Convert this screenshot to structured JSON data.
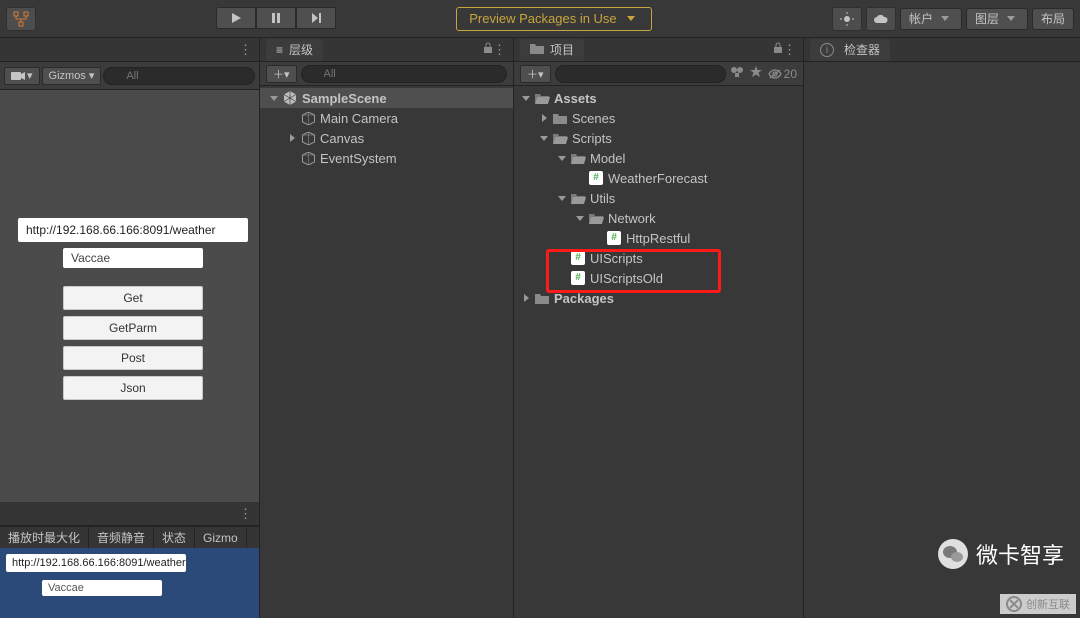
{
  "toolbar": {
    "preview_label": "Preview Packages in Use",
    "account_label": "帐户",
    "layers_label": "图层",
    "layout_label": "布局"
  },
  "scene": {
    "gizmos_label": "Gizmos",
    "search_placeholder": "All",
    "url_value": "http://192.168.66.166:8091/weather",
    "name_value": "Vaccae",
    "btn_get": "Get",
    "btn_getparm": "GetParm",
    "btn_post": "Post",
    "btn_json": "Json",
    "tabs": [
      "播放时最大化",
      "音频静音",
      "状态",
      "Gizmo"
    ],
    "game_url": "http://192.168.66.166:8091/weather",
    "game_name": "Vaccae"
  },
  "hierarchy": {
    "title": "层级",
    "search_placeholder": "All",
    "items": [
      {
        "label": "SampleScene",
        "icon": "unity",
        "bold": true,
        "sel": true,
        "depth": 0,
        "twist": "down"
      },
      {
        "label": "Main Camera",
        "icon": "cube",
        "depth": 1
      },
      {
        "label": "Canvas",
        "icon": "cube",
        "depth": 1,
        "twist": "right"
      },
      {
        "label": "EventSystem",
        "icon": "cube",
        "depth": 1
      }
    ]
  },
  "project": {
    "title": "项目",
    "hidden_count": "20",
    "items": [
      {
        "label": "Assets",
        "icon": "folder-o",
        "bold": true,
        "depth": 0,
        "twist": "down"
      },
      {
        "label": "Scenes",
        "icon": "folder",
        "depth": 1,
        "twist": "right"
      },
      {
        "label": "Scripts",
        "icon": "folder-o",
        "depth": 1,
        "twist": "down"
      },
      {
        "label": "Model",
        "icon": "folder-o",
        "depth": 2,
        "twist": "down"
      },
      {
        "label": "WeatherForecast",
        "icon": "cs",
        "depth": 3
      },
      {
        "label": "Utils",
        "icon": "folder-o",
        "depth": 2,
        "twist": "down"
      },
      {
        "label": "Network",
        "icon": "folder-o",
        "depth": 3,
        "twist": "down"
      },
      {
        "label": "HttpRestful",
        "icon": "cs",
        "depth": 4
      },
      {
        "label": "UIScripts",
        "icon": "cs",
        "depth": 2
      },
      {
        "label": "UIScriptsOld",
        "icon": "cs",
        "depth": 2
      },
      {
        "label": "Packages",
        "icon": "folder",
        "bold": true,
        "depth": 0,
        "twist": "right"
      }
    ]
  },
  "inspector": {
    "title": "检查器"
  },
  "watermark": {
    "wechat": "微卡智享",
    "corner": "创新互联"
  }
}
